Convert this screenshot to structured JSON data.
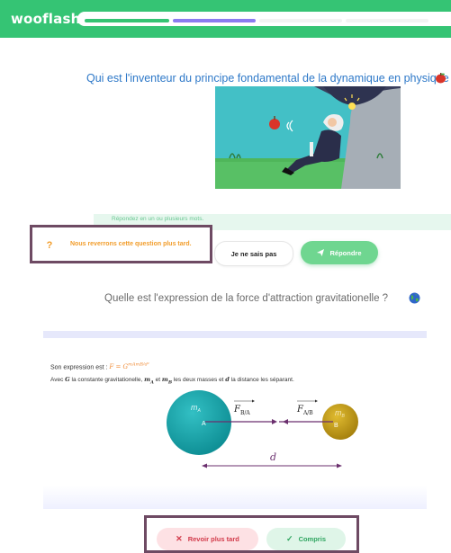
{
  "app": {
    "logo": "wooflash"
  },
  "progress": {
    "segments": [
      {
        "state": "done",
        "color": "#35c474"
      },
      {
        "state": "current",
        "color": "#8b7bf0"
      }
    ]
  },
  "question1": {
    "text": "Qui est l'inventeur du principe fondamental de la dynamique en physique ?",
    "icon": "apple-icon",
    "illustration": "newton-under-tree",
    "answer_hint": "Répondez en un ou plusieurs mots."
  },
  "actions1": {
    "later_icon": "?",
    "later_text": "Nous reverrons cette question plus tard.",
    "dont_know": "Je ne sais pas",
    "answer": "Répondre"
  },
  "question2": {
    "text": "Quelle est l'expression de la force d'attraction gravitationelle ?",
    "icon": "globe-icon",
    "explanation": {
      "expr_prefix": "Son expression est : ",
      "expr_formula": "F = G",
      "expr_frac": "mAmB",
      "expr_denom": "d²",
      "line2_a": "Avec ",
      "line2_G": "G",
      "line2_b": " la constante gravitationelle, ",
      "line2_mA": "m",
      "line2_mA_sub": "A",
      "line2_c": " et ",
      "line2_mB": "m",
      "line2_mB_sub": "B",
      "line2_d": " les deux masses et ",
      "line2_dvar": "d",
      "line2_e": " la distance les séparant."
    },
    "diagram": {
      "mass_a": "m",
      "mass_a_sub": "A",
      "label_a": "A",
      "mass_b": "m",
      "mass_b_sub": "B",
      "label_b": "B",
      "force_ba": "F",
      "force_ba_sub": "B/A",
      "force_ab": "F",
      "force_ab_sub": "A/B",
      "distance": "d",
      "colors": {
        "mass_a": "#1cabb0",
        "mass_b": "#c9a21a",
        "arrows": "#6b2f6e"
      }
    }
  },
  "actions2": {
    "revoir": "Revoir plus tard",
    "compris": "Compris"
  },
  "colors": {
    "brand": "#35c474",
    "accent_orange": "#f29d2b",
    "highlight_box": "#6e4a63"
  }
}
